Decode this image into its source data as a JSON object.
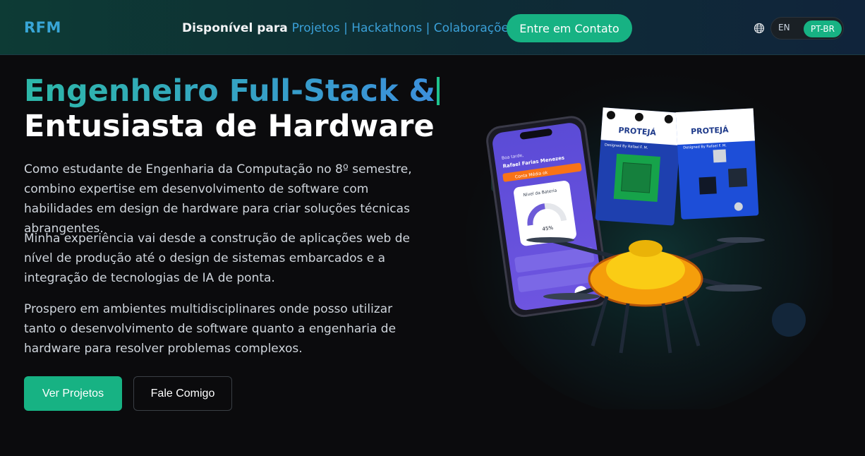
{
  "header": {
    "logo": "RFM",
    "availability_prefix": "Disponível para",
    "availability_items": "Projetos | Hackathons | Colaborações",
    "contact_button": "Entre em Contato",
    "globe_icon": "globe-icon",
    "languages": {
      "en": "EN",
      "pt": "PT-BR",
      "selected": "PT-BR"
    }
  },
  "hero": {
    "title_line1": "Engenheiro Full-Stack &",
    "title_line2": "Entusiasta de Hardware",
    "paragraph1": "Como estudante de Engenharia da Computação no 8º semestre, combino expertise em desenvolvimento de software com habilidades em design de hardware para criar soluções técnicas abrangentes.",
    "paragraph2": "Minha experiência vai desde a construção de aplicações web de nível de produção até o design de sistemas embarcados e a integração de tecnologias de IA de ponta.",
    "paragraph3": "Prospero em ambientes multidisciplinares onde posso utilizar tanto o desenvolvimento de software quanto a engenharia de hardware para resolver problemas complexos.",
    "primary_button": "Ver Projetos",
    "secondary_button": "Fale Comigo"
  },
  "illustration": {
    "phone_greeting": "Boa tarde,",
    "phone_name": "Rafael Farias Menezes",
    "phone_alert": "Conta Média ok",
    "battery_title": "Nível da Bateria",
    "battery_value": "45%",
    "board_label": "PROTEJÁ",
    "board_credit": "Designed By Rafael F. M."
  },
  "colors": {
    "accent_green": "#17b283",
    "accent_blue": "#38a5d6"
  }
}
